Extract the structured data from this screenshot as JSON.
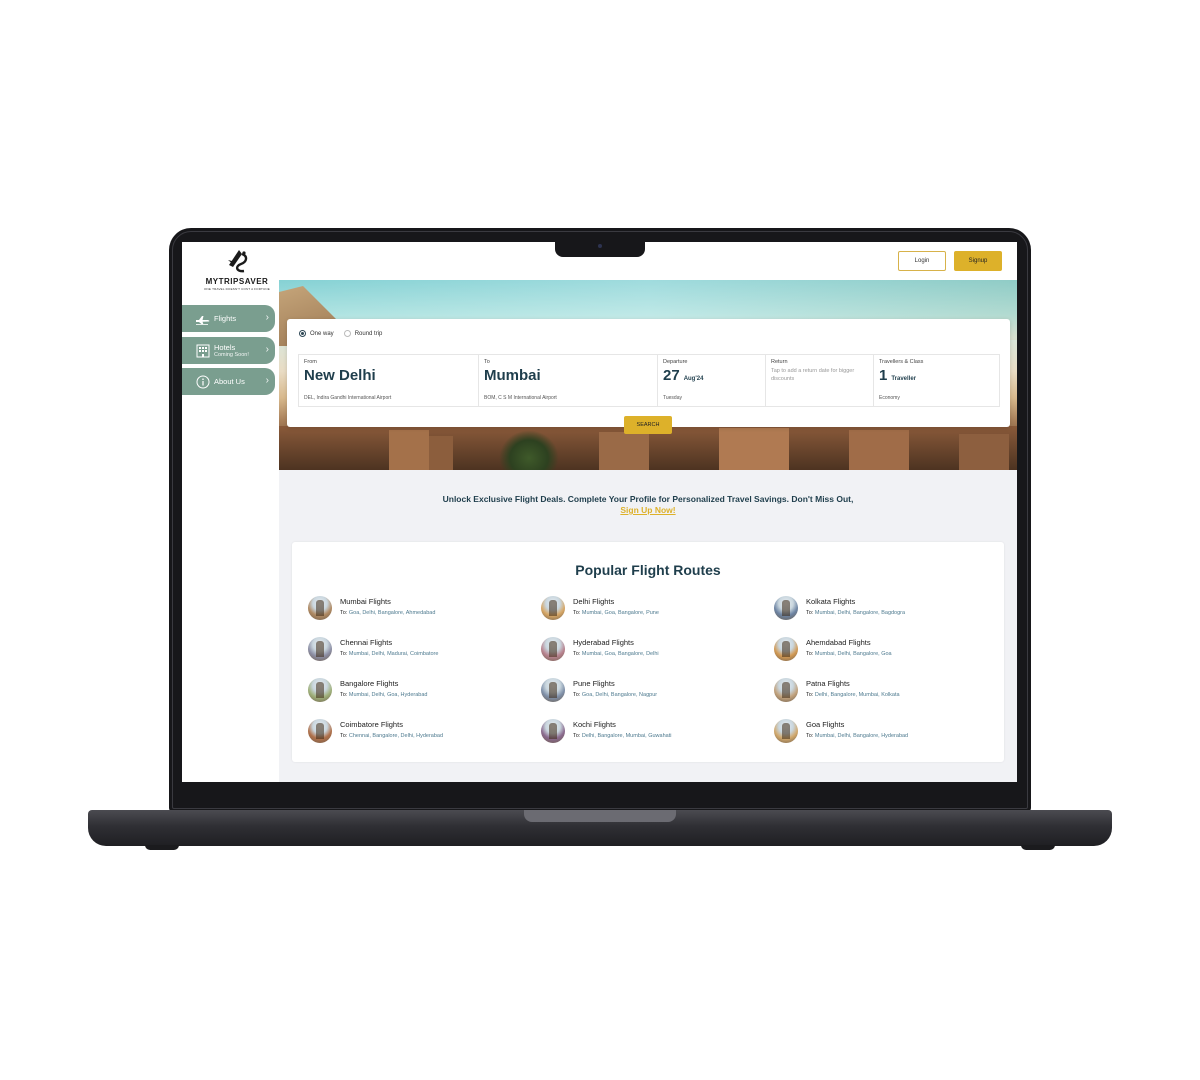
{
  "brand": {
    "name": "MYTRIPSAVER",
    "tagline": "ONE TRAVEL DOESN'T COST A FORTUNE"
  },
  "sidebar": {
    "items": [
      {
        "label": "Flights",
        "icon": "plane-icon"
      },
      {
        "label": "Hotels",
        "sublabel": "Coming Soon!",
        "icon": "building-icon"
      },
      {
        "label": "About Us",
        "icon": "info-icon"
      }
    ]
  },
  "header": {
    "login_label": "Login",
    "signup_label": "Signup"
  },
  "search": {
    "trip_types": [
      {
        "label": "One way",
        "selected": true
      },
      {
        "label": "Round trip",
        "selected": false
      }
    ],
    "from": {
      "caption": "From",
      "city": "New Delhi",
      "airport": "DEL, Indira Gandhi International Airport"
    },
    "to": {
      "caption": "To",
      "city": "Mumbai",
      "airport": "BOM, C S M International Airport"
    },
    "departure": {
      "caption": "Departure",
      "day": "27",
      "month": "Aug'24",
      "weekday": "Tuesday"
    },
    "return": {
      "caption": "Return",
      "hint": "Tap to add a return date for bigger discounts"
    },
    "travellers": {
      "caption": "Travellers & Class",
      "count": "1",
      "unit": "Traveller",
      "class": "Economy"
    },
    "search_label": "SEARCH"
  },
  "banner": {
    "text": "Unlock Exclusive Flight Deals. Complete Your Profile for Personalized Travel Savings. Don't Miss Out,",
    "link": "Sign Up Now!"
  },
  "routes": {
    "title": "Popular Flight Routes",
    "to_prefix": "To:",
    "items": [
      {
        "name": "Mumbai Flights",
        "dest": "Goa, Delhi, Bangalore, Ahmedabad",
        "color": "#b08a63"
      },
      {
        "name": "Delhi Flights",
        "dest": "Mumbai, Goa, Bangalore, Pune",
        "color": "#d7a766"
      },
      {
        "name": "Kolkata Flights",
        "dest": "Mumbai, Delhi, Bangalore, Bagdogra",
        "color": "#6d84a3"
      },
      {
        "name": "Chennai Flights",
        "dest": "Mumbai, Delhi, Madurai, Coimbatore",
        "color": "#8c8ea4"
      },
      {
        "name": "Hyderabad Flights",
        "dest": "Mumbai, Goa, Bangalore, Delhi",
        "color": "#b8838f"
      },
      {
        "name": "Ahemdabad Flights",
        "dest": "Mumbai, Delhi, Bangalore, Goa",
        "color": "#d29a55"
      },
      {
        "name": "Bangalore Flights",
        "dest": "Mumbai, Delhi, Goa, Hyderabad",
        "color": "#9fb07a"
      },
      {
        "name": "Pune Flights",
        "dest": "Goa, Delhi, Bangalore, Nagpur",
        "color": "#7e8fa8"
      },
      {
        "name": "Patna Flights",
        "dest": "Delhi, Bangalore, Mumbai, Kolkata",
        "color": "#c1a27d"
      },
      {
        "name": "Coimbatore Flights",
        "dest": "Chennai, Bangalore, Delhi, Hyderabad",
        "color": "#b0714b"
      },
      {
        "name": "Kochi Flights",
        "dest": "Delhi, Bangalore, Mumbai, Guwahati",
        "color": "#8a6a8e"
      },
      {
        "name": "Goa Flights",
        "dest": "Mumbai, Delhi, Bangalore, Hyderabad",
        "color": "#d1a86c"
      }
    ]
  },
  "colors": {
    "accent_gold": "#ddb12a",
    "sidebar_green": "#7a9e8f",
    "heading_navy": "#1f3e4c"
  }
}
